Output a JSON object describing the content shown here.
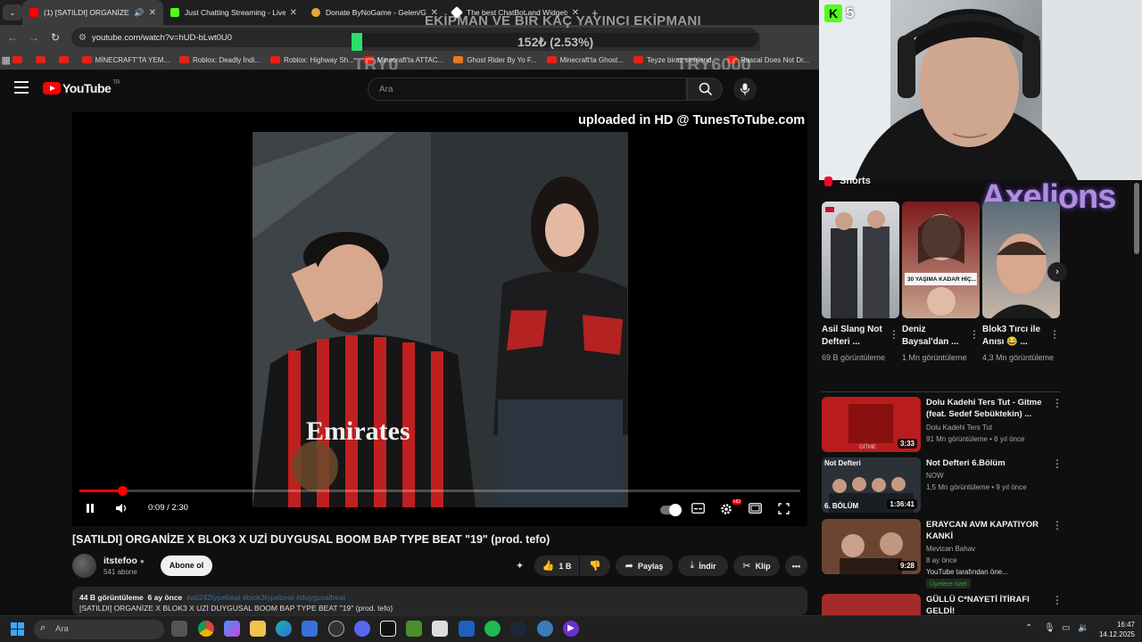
{
  "browser": {
    "tabs": [
      {
        "title": "(1) [SATILDI] ORGANİZE X B",
        "active": true,
        "favicon_color": "#ff0000"
      },
      {
        "title": "Just Chatting Streaming - Live S",
        "active": false,
        "favicon_color": "#53fc18"
      },
      {
        "title": "Donate ByNoGame - Gelen/Gi",
        "active": false,
        "favicon_color": "#e8a33d"
      },
      {
        "title": "The best ChatBot and Widgets",
        "active": false,
        "favicon_color": "#ffffff"
      }
    ],
    "url": "youtube.com/watch?v=hUD-bLwt0U0",
    "bookmarks": [
      {
        "label": "",
        "color": "#e62117"
      },
      {
        "label": "",
        "color": "#e62117"
      },
      {
        "label": "",
        "color": "#e62117"
      },
      {
        "label": "MİNECRAFT'TA YEM...",
        "color": "#e62117"
      },
      {
        "label": "Roblox: Deadly İndi...",
        "color": "#e62117"
      },
      {
        "label": "Roblox: Highway Sh...",
        "color": "#e62117"
      },
      {
        "label": "Minecraft'ta ATTAC...",
        "color": "#e62117"
      },
      {
        "label": "Ghost Rider By Yo F...",
        "color": "#e87722"
      },
      {
        "label": "Minecraft'ta Ghost...",
        "color": "#e62117"
      },
      {
        "label": "Teyze biraz sinirlend...",
        "color": "#e62117"
      },
      {
        "label": "Rascal Does Not Dr...",
        "color": "#e62117"
      }
    ]
  },
  "overlay": {
    "goal_title": "EKİPMAN VE BİR KAÇ YAYINCI EKİPMANI",
    "goal_progress_text": "152₺ (2.53%)",
    "goal_fraction": 0.0253,
    "goal_min": "TRY0",
    "goal_max": "TRY6000",
    "kick_viewers": "5",
    "watermark": "Axelions"
  },
  "youtube": {
    "logo_text": "YouTube",
    "logo_suffix": "TR",
    "search_placeholder": "Ara",
    "player": {
      "watermark": "uploaded in HD @ TunesToTube.com",
      "time_display": "0:09 / 2:30",
      "progress_fraction": 0.06
    },
    "video": {
      "title": "[SATILDI] ORGANİZE X BLOK3 X UZİ DUYGUSAL BOOM BAP TYPE BEAT \"19\" (prod. tefo)",
      "channel": "itstefoo",
      "subscribers": "541 abone",
      "subscribe_label": "Abone ol",
      "likes": "1 B",
      "share_label": "Paylaş",
      "download_label": "İndir",
      "clip_label": "Klip",
      "views": "44 B görüntüleme",
      "age": "6 ay önce",
      "tags": "#ati242typebeat #blok3typebeat #duygusalbeat",
      "desc_line": "[SATILDI] ORGANİZE X BLOK3 X UZİ DUYGUSAL BOOM BAP TYPE BEAT \"19\" (prod. tefo)"
    },
    "shorts_heading": "Shorts",
    "shorts": [
      {
        "title": "Asil Slang Not Defteri ...",
        "views": "69 B görüntüleme"
      },
      {
        "title": "Deniz Baysal'dan ...",
        "views": "1 Mn görüntüleme",
        "overlay_text": "30 YAŞIMA KADAR HİÇ..."
      },
      {
        "title": "Blok3 Tırcı ile Anısı 😂 ...",
        "views": "4,3 Mn görüntüleme"
      }
    ],
    "recommendations": [
      {
        "title": "Dolu Kadehi Ters Tut - Gitme (feat. Sedef Sebüktekin) ...",
        "channel": "Dolu Kadehi Ters Tut",
        "meta": "91 Mn görüntüleme • 6 yıl önce",
        "duration": "3:33"
      },
      {
        "title": "Not Defteri 6.Bölüm",
        "channel": "NOW",
        "meta": "1,5 Mn görüntüleme • 9 yıl önce",
        "duration": "1:36:41",
        "thumb_text": "Not Defteri",
        "thumb_sub": "6. BÖLÜM"
      },
      {
        "title": "ERAYCAN AVM KAPATIYOR KANKİ",
        "channel": "Mevtcan Bahav",
        "meta": "8 ay önce",
        "meta2": "YouTube tarafından öne...",
        "badge": "Üyelere özel",
        "duration": "9:28"
      },
      {
        "title": "GÜLLÜ C*NAYETİ İTİRAFI GELDİ!",
        "channel": "",
        "meta": "",
        "duration": ""
      }
    ]
  },
  "taskbar": {
    "search_placeholder": "Ara",
    "time": "16:47",
    "date": "14.12.2025"
  }
}
